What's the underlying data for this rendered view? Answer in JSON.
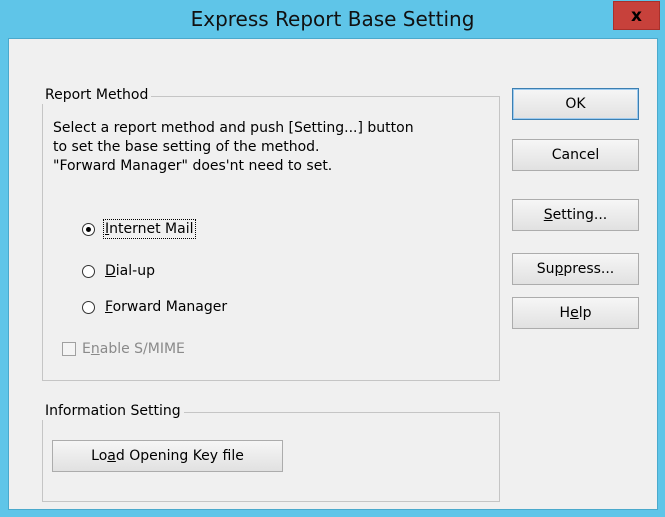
{
  "window": {
    "title": "Express Report Base Setting",
    "close_label": "x"
  },
  "report_method": {
    "legend": "Report Method",
    "description": "Select a report method and push [Setting...] button\nto set the base setting of the method.\n\"Forward Manager\" does'nt need to set.",
    "options": [
      {
        "pre": "",
        "accel": "I",
        "post": "nternet Mail",
        "checked": true
      },
      {
        "pre": "",
        "accel": "D",
        "post": "ial-up",
        "checked": false
      },
      {
        "pre": "",
        "accel": "F",
        "post": "orward Manager",
        "checked": false
      }
    ],
    "smime": {
      "pre": "E",
      "accel": "n",
      "post": "able S/MIME",
      "checked": false,
      "enabled": false
    }
  },
  "information_setting": {
    "legend": "Information Setting",
    "load_button": {
      "pre": "Lo",
      "accel": "a",
      "post": "d Opening Key file"
    }
  },
  "buttons": {
    "ok": {
      "pre": "OK",
      "accel": "",
      "post": ""
    },
    "cancel": {
      "pre": "Cancel",
      "accel": "",
      "post": ""
    },
    "setting": {
      "pre": "",
      "accel": "S",
      "post": "etting..."
    },
    "suppress": {
      "pre": "Su",
      "accel": "p",
      "post": "press..."
    },
    "help": {
      "pre": "H",
      "accel": "e",
      "post": "lp"
    }
  }
}
